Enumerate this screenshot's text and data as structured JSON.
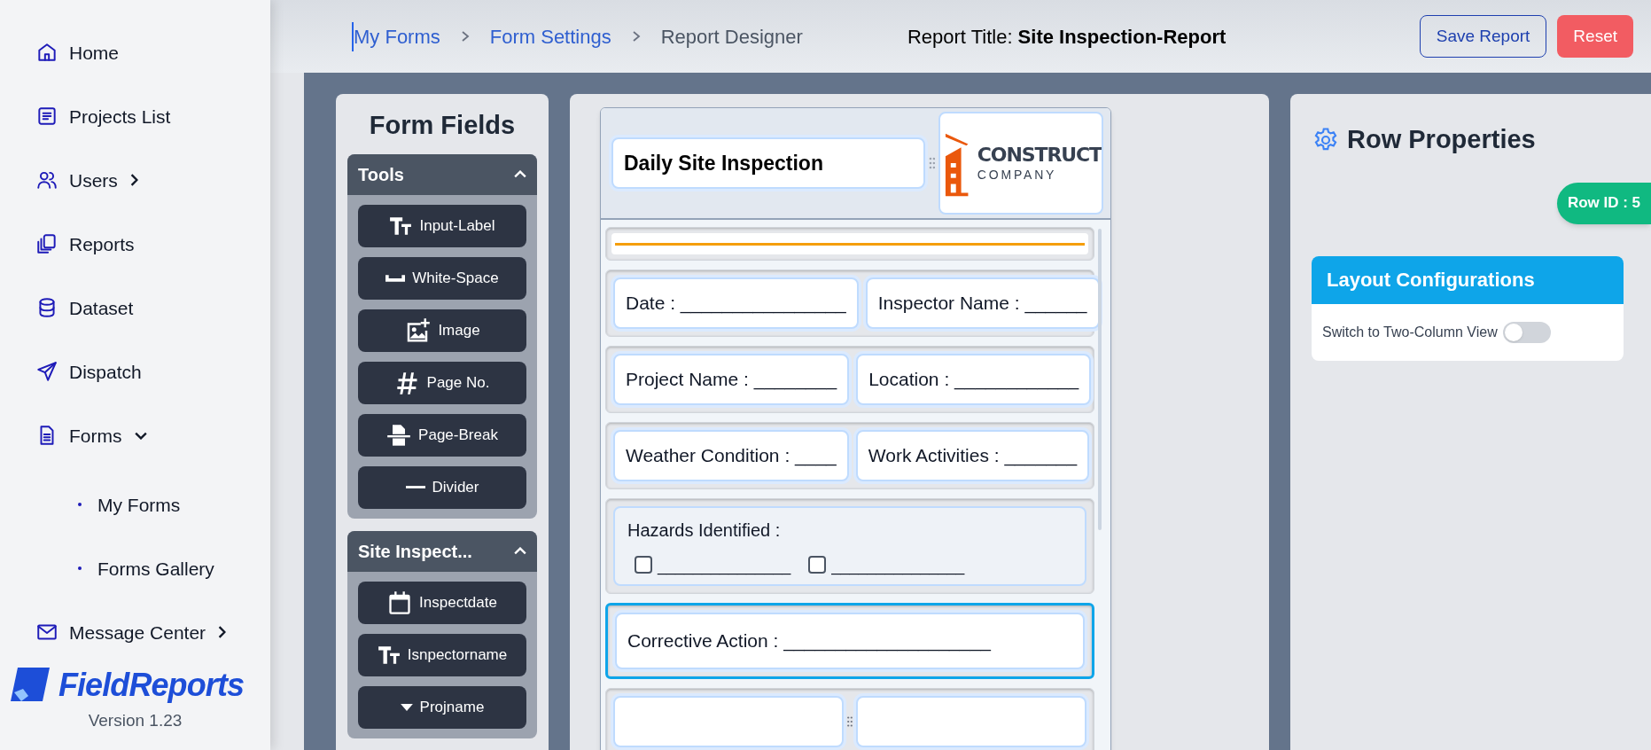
{
  "sidebar": {
    "items": [
      {
        "kind": "link",
        "label": "Home"
      },
      {
        "kind": "link",
        "label": "Projects List"
      },
      {
        "kind": "group",
        "label": "Users",
        "expanded": false
      },
      {
        "kind": "link",
        "label": "Reports"
      },
      {
        "kind": "link",
        "label": "Dataset"
      },
      {
        "kind": "link",
        "label": "Dispatch"
      },
      {
        "kind": "group",
        "label": "Forms",
        "expanded": true,
        "children": [
          {
            "label": "My Forms"
          },
          {
            "label": "Forms Gallery"
          }
        ]
      },
      {
        "kind": "group",
        "label": "Message Center",
        "expanded": false
      }
    ],
    "brand": "FieldReports",
    "version": "Version 1.23"
  },
  "header": {
    "breadcrumbs": [
      {
        "label": "My Forms",
        "kind": "link"
      },
      {
        "label": "Form Settings",
        "kind": "link"
      },
      {
        "label": "Report Designer",
        "kind": "current"
      }
    ],
    "report_title": "Report Title: **Site Inspection-Report**",
    "buttons": [
      {
        "label": "Save Report",
        "kind": "outline"
      },
      {
        "label": "Reset",
        "kind": "danger"
      }
    ]
  },
  "form_fields": {
    "title": "Form Fields",
    "sections": [
      {
        "title": "Tools",
        "expanded": true,
        "items": [
          "Input-Label",
          "White-Space",
          "Image",
          "Page No.",
          "Page-Break",
          "Divider"
        ]
      },
      {
        "title": "Site Inspect...",
        "expanded": true,
        "items": [
          "Inspectdate",
          "Isnpectorname",
          "Projname"
        ]
      }
    ]
  },
  "canvas": {
    "header": {
      "title": "Daily Site Inspection",
      "logo_name": "CONSTRUCT",
      "logo_sub": "COMPANY"
    },
    "rows": [
      {
        "kind": "divider",
        "selected": false
      },
      {
        "kind": "pair",
        "selected": false,
        "cells": [
          "Date : ________________",
          "Inspector Name : ______"
        ]
      },
      {
        "kind": "pair",
        "selected": false,
        "cells": [
          "Project Name : ________",
          "Location : ____________"
        ]
      },
      {
        "kind": "pair",
        "selected": false,
        "cells": [
          "Weather Condition : ____",
          "Work Activities : _______"
        ]
      },
      {
        "kind": "checklist",
        "selected": false,
        "label": "Hazards Identified :",
        "options": [
          {
            "checked": false,
            "text": "_______________"
          },
          {
            "checked": false,
            "text": "_______________"
          }
        ]
      },
      {
        "kind": "single",
        "selected": true,
        "cells": [
          "Corrective Action : ____________________"
        ]
      },
      {
        "kind": "pair",
        "selected": false,
        "cells": []
      }
    ]
  },
  "row_properties": {
    "title": "Row Properties",
    "badge": "Row ID : 5",
    "section": "Layout Configurations",
    "toggle": {
      "label": "Switch to Two-Column View",
      "on": false
    }
  }
}
